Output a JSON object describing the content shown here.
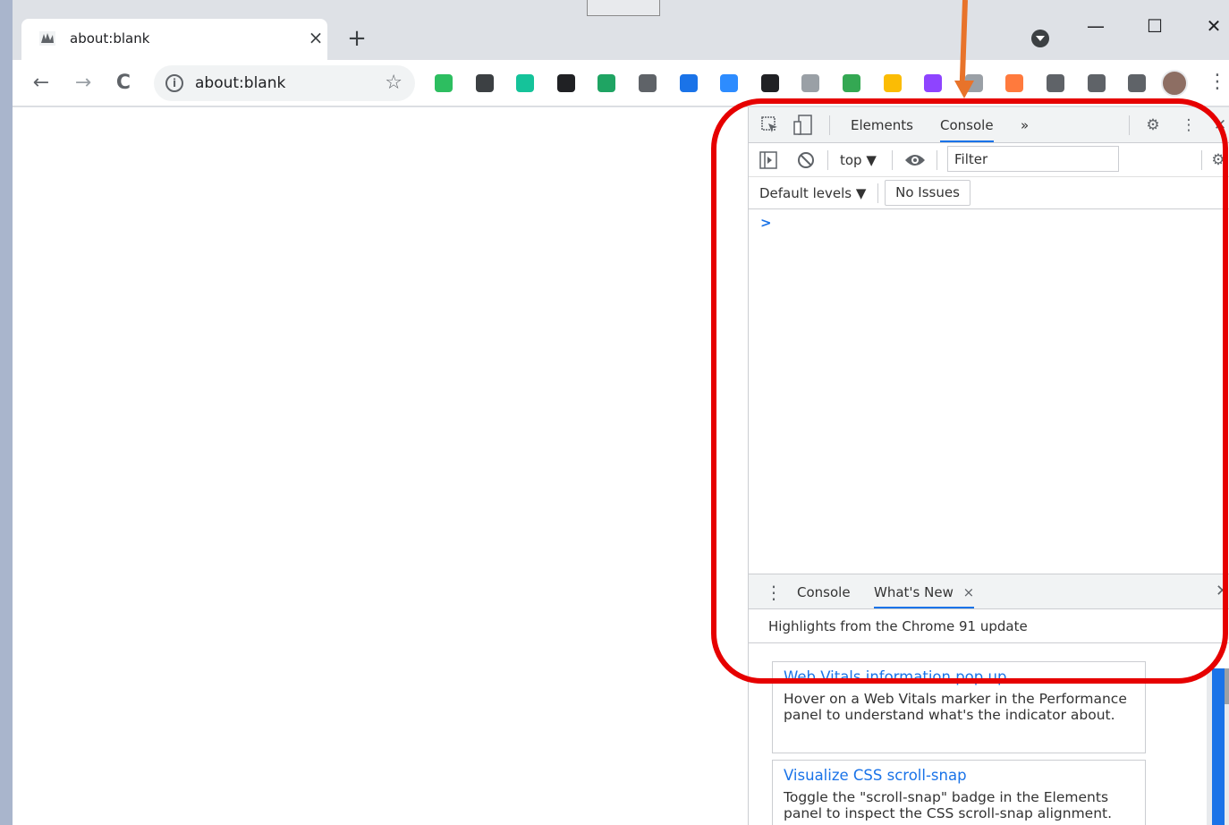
{
  "browser": {
    "tab_title": "about:blank",
    "tab_close": "×",
    "new_tab": "+",
    "address": "about:blank",
    "window_controls": {
      "minimize": "—",
      "maximize": "☐",
      "close": "✕"
    },
    "nav": {
      "back": "←",
      "forward": "→",
      "reload": "C"
    },
    "extensions": [
      {
        "name": "evernote-icon",
        "color": "#2dbe60"
      },
      {
        "name": "pinterest-icon",
        "color": "#3c4043"
      },
      {
        "name": "grammarly-icon",
        "color": "#15c39a"
      },
      {
        "name": "extension-dark-icon",
        "color": "#202124"
      },
      {
        "name": "google-drive-icon",
        "color": "#1fa463"
      },
      {
        "name": "cast-icon",
        "color": "#5f6368"
      },
      {
        "name": "blue-app-icon",
        "color": "#1a73e8"
      },
      {
        "name": "zoom-icon",
        "color": "#2d8cff"
      },
      {
        "name": "grid-icon",
        "color": "#202124"
      },
      {
        "name": "apple-icon",
        "color": "#9aa0a6"
      },
      {
        "name": "timer-icon",
        "color": "#34a853"
      },
      {
        "name": "shield-icon",
        "color": "#fbbc04"
      },
      {
        "name": "b-icon",
        "color": "#8e44ff"
      },
      {
        "name": "tag-icon",
        "color": "#9aa0a6"
      },
      {
        "name": "orange-app-icon",
        "color": "#ff7a3d"
      },
      {
        "name": "person-icon",
        "color": "#5f6368"
      },
      {
        "name": "puzzle-icon",
        "color": "#5f6368"
      },
      {
        "name": "media-icon",
        "color": "#5f6368"
      }
    ]
  },
  "devtools": {
    "tabs": {
      "elements": "Elements",
      "console": "Console",
      "more": "»"
    },
    "context": "top ▼",
    "filter_placeholder": "Filter",
    "levels": "Default levels ▼",
    "issues": "No Issues",
    "prompt": ">",
    "drawer": {
      "console": "Console",
      "whats_new": "What's New",
      "close": "×"
    },
    "highlights": "Highlights from the Chrome 91 update",
    "cards": [
      {
        "title": "Web Vitals information pop up",
        "desc": "Hover on a Web Vitals marker in the Performance panel to understand what's the indicator about."
      },
      {
        "title": "Visualize CSS scroll-snap",
        "desc": "Toggle the \"scroll-snap\" badge in the Elements panel to inspect the CSS scroll-snap alignment."
      }
    ]
  },
  "colors": {
    "annotation_box": "#e60000",
    "annotation_arrow": "#e8732a",
    "accent": "#1a73e8"
  }
}
